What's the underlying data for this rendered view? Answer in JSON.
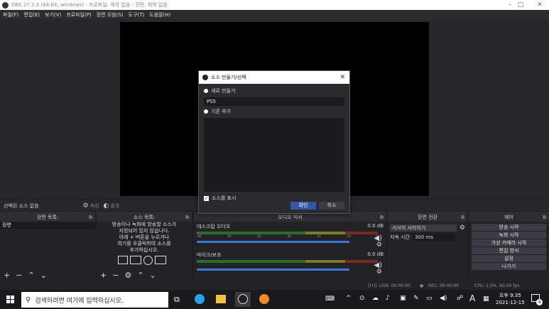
{
  "window": {
    "title": "OBS 27.1.3 (64-bit, windows) - 프로파일: 제목 없음 - 장면: 제목 없음"
  },
  "menubar": {
    "items": [
      "파일(F)",
      "편집(E)",
      "보기(V)",
      "프로파일(P)",
      "장면 모음(S)",
      "도구(T)",
      "도움말(H)"
    ]
  },
  "context_bar": {
    "no_source": "선택된 소스 없음",
    "properties": "속성",
    "filters": "효과"
  },
  "docks": {
    "scenes": {
      "title": "장면 목록:",
      "items": [
        "장면"
      ]
    },
    "sources": {
      "title": "소스 목록:",
      "empty_hint": [
        "방송이나 녹화에 방송할 소스가",
        "지정되어 있지 않습니다.",
        "아래 + 버튼을 누르거나",
        "여기를 우클릭하여 소스를",
        "추가하십시오."
      ]
    },
    "mixer": {
      "title": "오디오 믹서",
      "tracks": [
        {
          "name": "데스크탑 오디오",
          "level": "0.0 dB"
        },
        {
          "name": "마이크/보조",
          "level": "0.0 dB"
        }
      ],
      "ticks": [
        "-60",
        "-55",
        "-50",
        "-45",
        "-40",
        "-35",
        "-30",
        "-25",
        "-20",
        "-15",
        "-10",
        "-5",
        "0"
      ]
    },
    "transitions": {
      "title": "장면 전환",
      "selected": "서서히 사라지기",
      "duration_label": "지속 시간",
      "duration_value": "300 ms"
    },
    "controls": {
      "title": "제어",
      "buttons": [
        "방송 시작",
        "녹화 시작",
        "가상 카메라 시작",
        "편집 방식",
        "설정",
        "나가기"
      ]
    }
  },
  "status": {
    "live": "LIVE: 00:00:00",
    "rec": "REC: 00:00:00",
    "cpu": "CPU: 1.5%, 60.00 fps"
  },
  "dialog": {
    "title": "소스 만들기/선택",
    "create_new": "새로 만들기",
    "name_value": "PS5",
    "add_existing": "기존 추가",
    "make_visible": "소스를 표시",
    "ok": "확인",
    "cancel": "취소"
  },
  "taskbar": {
    "search_placeholder": "검색하려면 여기에 입력하십시오.",
    "time": "오후 9:35",
    "date": "2021-12-15",
    "ime": "A",
    "notification_count": "4"
  }
}
